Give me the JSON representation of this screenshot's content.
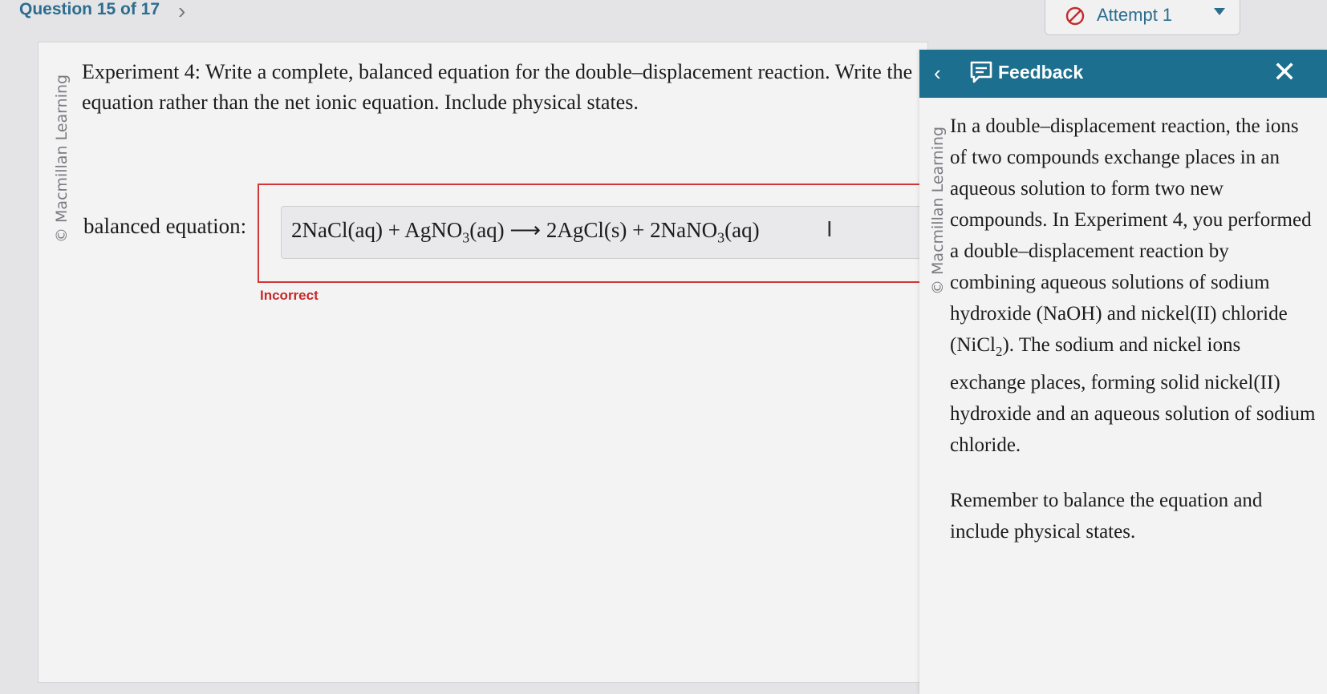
{
  "header": {
    "question_counter": "Question 15 of 17",
    "attempt_label": "Attempt 1",
    "accent_color": "#2c6d8f"
  },
  "question": {
    "watermark": "© Macmillan Learning",
    "prompt": "Experiment 4: Write a complete, balanced equation for the double–displacement reaction. Write the equation rather than the net ionic equation. Include physical states.",
    "answer_label": "balanced equation:",
    "answer": {
      "lhs1": "2NaCl(aq) + AgNO",
      "lhs1_sub": "3",
      "lhs2": "(aq)",
      "arrow": "⟶",
      "rhs1": "2AgCl(s) + 2NaNO",
      "rhs1_sub": "3",
      "rhs2": "(aq)"
    },
    "status": "Incorrect",
    "status_color": "#c62a2a"
  },
  "feedback": {
    "title": "Feedback",
    "watermark": "© Macmillan Learning",
    "paragraph1_a": "In a double–displacement reaction, the ions of two compounds exchange places in an aqueous solution to form two new compounds. In Experiment 4, you performed a double–displacement reaction by combining aqueous solutions of sodium hydroxide (NaOH) and nickel(II) chloride (NiCl",
    "paragraph1_sub": "2",
    "paragraph1_b": "). The sodium and nickel ions exchange places, forming solid nickel(II) hydroxide and an aqueous solution of sodium chloride.",
    "paragraph2": "Remember to balance the equation and include physical states.",
    "header_color": "#1c6f8e"
  }
}
